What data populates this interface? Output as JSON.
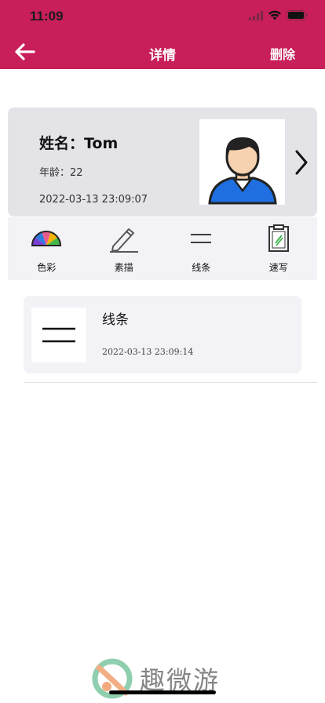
{
  "status_bar": {
    "time": "11:09"
  },
  "nav": {
    "title": "详情",
    "delete_label": "删除"
  },
  "profile": {
    "name": "姓名：Tom",
    "age": "年龄：22",
    "date": "2022-03-13 23:09:07"
  },
  "categories": [
    {
      "label": "色彩",
      "icon": "color-wheel-icon"
    },
    {
      "label": "素描",
      "icon": "pencil-icon"
    },
    {
      "label": "线条",
      "icon": "lines-icon"
    },
    {
      "label": "速写",
      "icon": "clipboard-icon"
    }
  ],
  "records": [
    {
      "title": "线条",
      "date": "2022-03-13 23:09:14",
      "icon": "lines-icon"
    }
  ],
  "watermark": {
    "text": "趣微游"
  },
  "colors": {
    "brand": "#c81e5a",
    "card_bg": "#e3e3e8",
    "panel_bg": "#f2f2f7"
  }
}
